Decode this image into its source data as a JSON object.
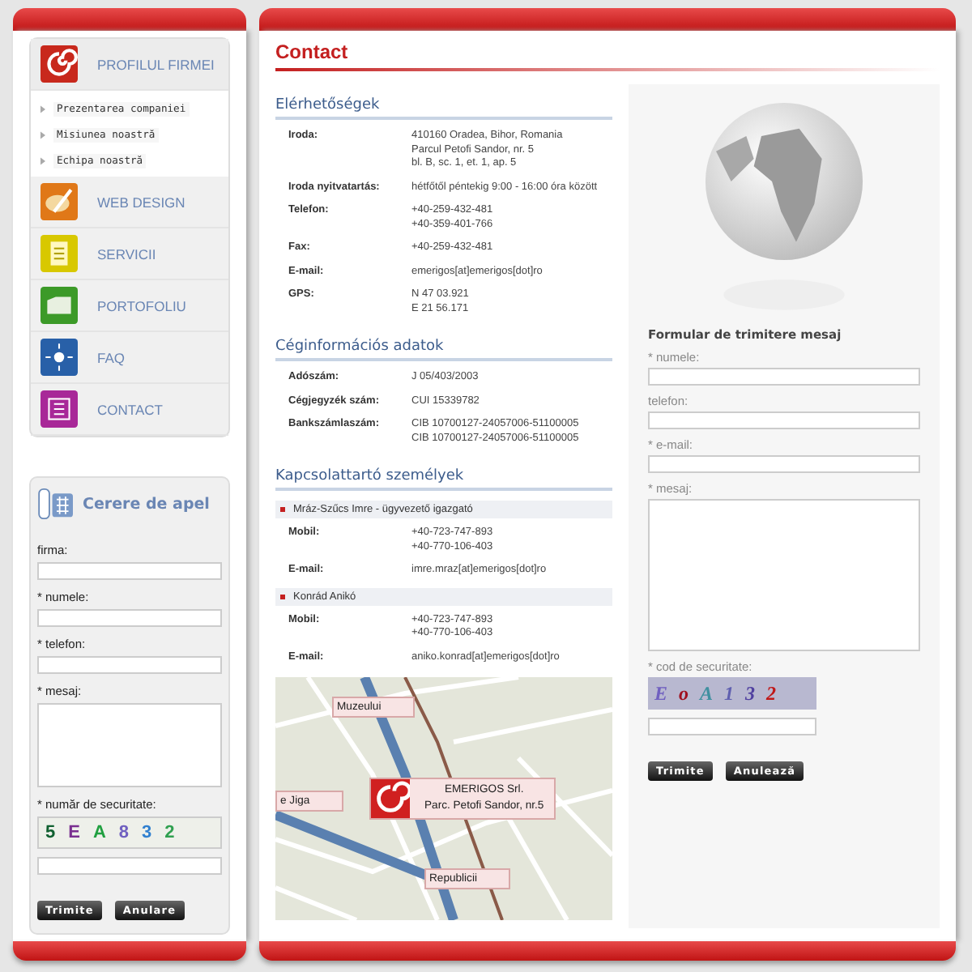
{
  "left_menu": {
    "items": [
      {
        "label": "PROFILUL FIRMEI",
        "expanded": true,
        "children": [
          {
            "label": "Prezentarea companiei"
          },
          {
            "label": "Misiunea noastră"
          },
          {
            "label": "Echipa noastră"
          }
        ]
      },
      {
        "label": "WEB DESIGN"
      },
      {
        "label": "SERVICII"
      },
      {
        "label": "PORTOFOLIU"
      },
      {
        "label": "FAQ"
      },
      {
        "label": "CONTACT"
      }
    ]
  },
  "callback_form": {
    "title": "Cerere de apel",
    "fields": [
      {
        "label": "firma:",
        "kind": "text"
      },
      {
        "label": "* numele:",
        "kind": "text"
      },
      {
        "label": "* telefon:",
        "kind": "text"
      },
      {
        "label": "* mesaj:",
        "kind": "textarea"
      },
      {
        "label": "* număr de securitate:",
        "kind": "captcha",
        "captcha": [
          "5",
          "E",
          "A",
          "8",
          "3",
          "2"
        ]
      }
    ],
    "buttons": [
      "Trimite",
      "Anulare"
    ]
  },
  "page": {
    "title": "Contact"
  },
  "sections": [
    {
      "kind": "details",
      "heading": "Elérhetőségek",
      "rows": [
        {
          "label": "Iroda:",
          "lines": [
            "410160 Oradea, Bihor, Romania",
            "Parcul Petofi Sandor, nr. 5",
            "bl. B, sc. 1, et. 1, ap. 5"
          ]
        },
        {
          "label": "Iroda nyitvatartás:",
          "lines": [
            "hétfőtől péntekig 9:00 - 16:00 óra között"
          ]
        },
        {
          "label": "Telefon:",
          "lines": [
            "+40-259-432-481",
            "+40-359-401-766"
          ]
        },
        {
          "label": "Fax:",
          "lines": [
            "+40-259-432-481"
          ]
        },
        {
          "label": "E-mail:",
          "lines": [
            "emerigos[at]emerigos[dot]ro"
          ]
        },
        {
          "label": "GPS:",
          "lines": [
            "N 47 03.921",
            "E 21 56.171"
          ]
        }
      ]
    },
    {
      "kind": "details",
      "heading": "Céginformációs adatok",
      "rows": [
        {
          "label": "Adószám:",
          "lines": [
            "J 05/403/2003"
          ]
        },
        {
          "label": "Cégjegyzék szám:",
          "lines": [
            "CUI 15339782"
          ]
        },
        {
          "label": "Bankszámlaszám:",
          "lines": [
            "CIB 10700127-24057006-51100005",
            "CIB 10700127-24057006-51100005"
          ]
        }
      ]
    },
    {
      "kind": "contacts",
      "heading": "Kapcsolattartó személyek",
      "persons": [
        {
          "name": "Mráz-Szűcs Imre - ügyvezető igazgató",
          "rows": [
            {
              "label": "Mobil:",
              "lines": [
                "+40-723-747-893",
                "+40-770-106-403"
              ]
            },
            {
              "label": "E-mail:",
              "lines": [
                "imre.mraz[at]emerigos[dot]ro"
              ]
            }
          ]
        },
        {
          "name": "Konrád Anikó",
          "rows": [
            {
              "label": "Mobil:",
              "lines": [
                "+40-723-747-893",
                "+40-770-106-403"
              ]
            },
            {
              "label": "E-mail:",
              "lines": [
                "aniko.konrad[at]emerigos[dot]ro"
              ]
            }
          ]
        }
      ]
    }
  ],
  "map": {
    "markers": [
      {
        "kind": "street",
        "text": "Muzeului"
      },
      {
        "kind": "street",
        "text": "e Jiga"
      },
      {
        "kind": "company",
        "lines": [
          "EMERIGOS Srl.",
          "Parc. Petofi Sandor, nr.5"
        ]
      },
      {
        "kind": "street",
        "text": "Republicii"
      }
    ]
  },
  "contact_form": {
    "title": "Formular de trimitere mesaj",
    "fields": [
      {
        "label": "* numele:",
        "kind": "text"
      },
      {
        "label": "telefon:",
        "kind": "text"
      },
      {
        "label": "* e-mail:",
        "kind": "text"
      },
      {
        "label": "* mesaj:",
        "kind": "textarea"
      },
      {
        "label": "* cod de securitate:",
        "kind": "captcha",
        "captcha": [
          "E",
          "o",
          "A",
          "1",
          "3",
          "2"
        ]
      }
    ],
    "buttons": [
      "Trimite",
      "Anulează"
    ]
  }
}
